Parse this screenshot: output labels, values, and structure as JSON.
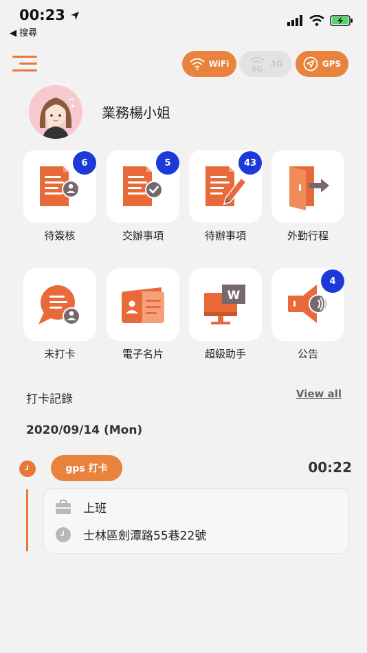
{
  "status": {
    "time": "00:23",
    "back_label": "◀ 搜尋"
  },
  "connectivity": {
    "wifi": "WiFi",
    "g4": "4G",
    "gps": "GPS"
  },
  "user": {
    "name": "業務楊小姐"
  },
  "tiles": [
    {
      "label": "待簽核",
      "badge": "6"
    },
    {
      "label": "交辦事項",
      "badge": "5"
    },
    {
      "label": "待辦事項",
      "badge": "43"
    },
    {
      "label": "外勤行程"
    },
    {
      "label": "未打卡"
    },
    {
      "label": "電子名片"
    },
    {
      "label": "超級助手"
    },
    {
      "label": "公告",
      "badge": "4"
    }
  ],
  "records": {
    "title": "打卡記錄",
    "view_all": "View all",
    "date": "2020/09/14 (Mon)",
    "entry": {
      "type_label": "gps 打卡",
      "time": "00:22",
      "shift": "上班",
      "address": "士林區劍潭路55巷22號"
    }
  },
  "colors": {
    "accent": "#e8823c",
    "badge": "#1d3ad8",
    "background": "#f2f2f2"
  }
}
